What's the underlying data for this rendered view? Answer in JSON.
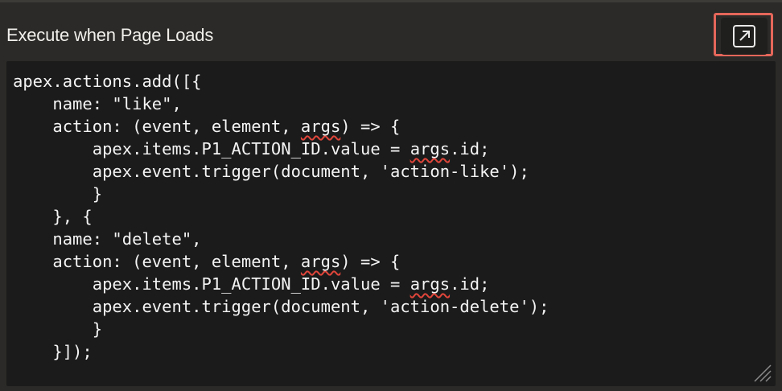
{
  "field": {
    "label": "Execute when Page Loads",
    "expand_button_icon": "expand-icon"
  },
  "editor": {
    "lines": [
      [
        {
          "t": "apex.actions.add([{"
        }
      ],
      [
        {
          "t": "    name: \"like\","
        }
      ],
      [
        {
          "t": "    action: (event, element, "
        },
        {
          "t": "args",
          "squiggle": true
        },
        {
          "t": ") => {"
        }
      ],
      [
        {
          "t": "        apex.items.P1_ACTION_ID.value = "
        },
        {
          "t": "args",
          "squiggle": true
        },
        {
          "t": ".id;"
        }
      ],
      [
        {
          "t": "        apex.event.trigger(document, 'action-like');"
        }
      ],
      [
        {
          "t": "        }"
        }
      ],
      [
        {
          "t": "    }, {"
        }
      ],
      [
        {
          "t": "    name: \"delete\","
        }
      ],
      [
        {
          "t": "    action: (event, element, "
        },
        {
          "t": "args",
          "squiggle": true
        },
        {
          "t": ") => {"
        }
      ],
      [
        {
          "t": "        apex.items.P1_ACTION_ID.value = "
        },
        {
          "t": "args",
          "squiggle": true
        },
        {
          "t": ".id;"
        }
      ],
      [
        {
          "t": "        apex.event.trigger(document, 'action-delete');"
        }
      ],
      [
        {
          "t": "        }"
        }
      ],
      [
        {
          "t": "    }]);"
        }
      ]
    ]
  },
  "colors": {
    "background": "#2b2a28",
    "editor_background": "#1b1b1b",
    "code_text": "#f4f4f4",
    "highlight_border": "#e5675a",
    "spellcheck_squiggle": "#e0453a"
  }
}
